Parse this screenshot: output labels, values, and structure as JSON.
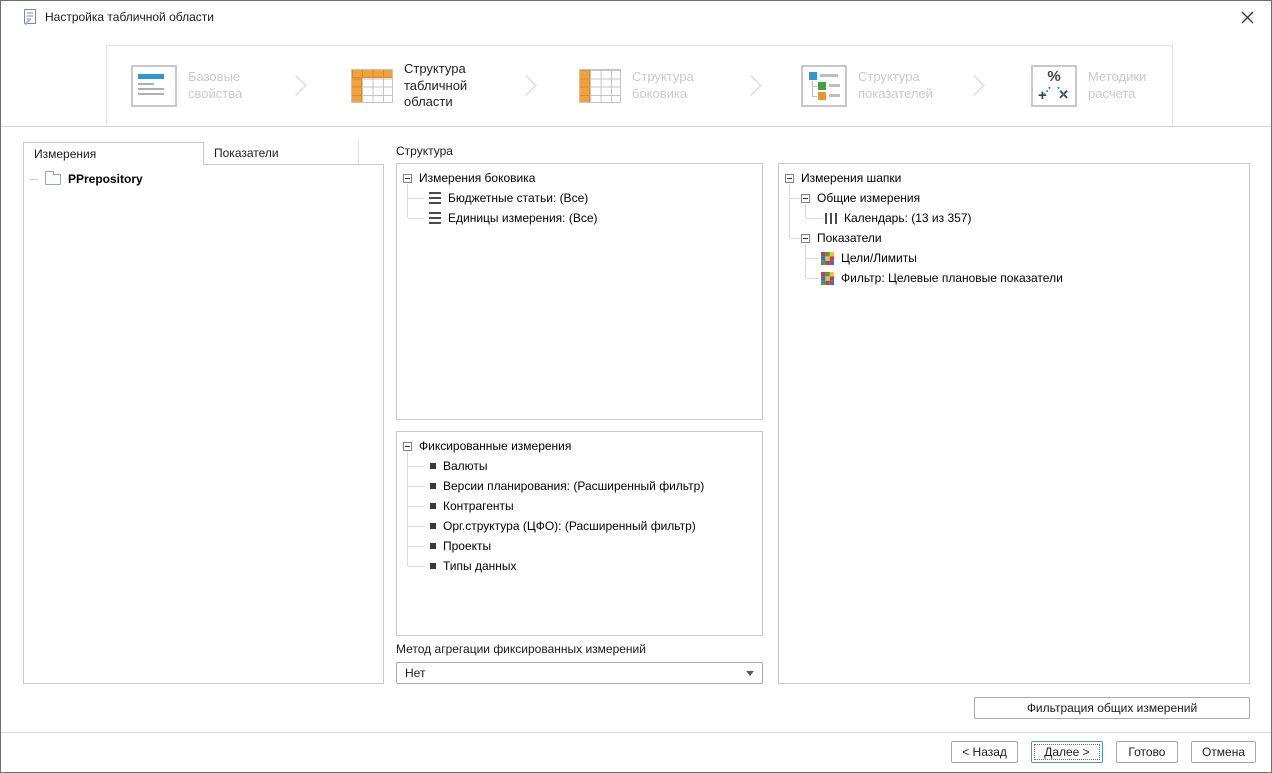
{
  "window": {
    "title": "Настройка табличной области"
  },
  "colors": {
    "accent_orange": "#F0A23C",
    "accent_blue": "#2E96D4",
    "accent_green": "#43A047"
  },
  "wizard": {
    "steps": [
      {
        "label": "Базовые свойства",
        "icon": "document-icon",
        "active": false
      },
      {
        "label": "Структура табличной области",
        "icon": "grid-top-left-icon",
        "active": true
      },
      {
        "label": "Структура боковика",
        "icon": "grid-left-icon",
        "active": false
      },
      {
        "label": "Структура показателей",
        "icon": "tree-structure-icon",
        "active": false
      },
      {
        "label": "Методики расчета",
        "icon": "percent-calc-icon",
        "active": false
      }
    ]
  },
  "tabs": [
    {
      "label": "Измерения",
      "active": true
    },
    {
      "label": "Показатели",
      "active": false
    }
  ],
  "left_tree": {
    "root": "PPrepository"
  },
  "structure": {
    "label": "Структура",
    "side_dims": {
      "header": "Измерения боковика",
      "items": [
        "Бюджетные статьи: (Все)",
        "Единицы измерения: (Все)"
      ]
    },
    "fixed_dims": {
      "header": "Фиксированные измерения",
      "items": [
        "Валюты",
        "Версии планирования: (Расширенный фильтр)",
        "Контрагенты",
        "Орг.структура (ЦФО): (Расширенный фильтр)",
        "Проекты",
        "Типы данных"
      ]
    },
    "aggregation": {
      "label": "Метод агрегации фиксированных измерений",
      "value": "Нет"
    }
  },
  "header_dims": {
    "root": "Измерения шапки",
    "common": {
      "header": "Общие измерения",
      "items": [
        "Календарь: (13 из 357)"
      ]
    },
    "indicators": {
      "header": "Показатели",
      "items": [
        "Цели/Лимиты",
        "Фильтр: Целевые плановые показатели"
      ]
    }
  },
  "buttons": {
    "filter": "Фильтрация общих измерений",
    "back": "< Назад",
    "next": "Далее >",
    "finish": "Готово",
    "cancel": "Отмена"
  }
}
